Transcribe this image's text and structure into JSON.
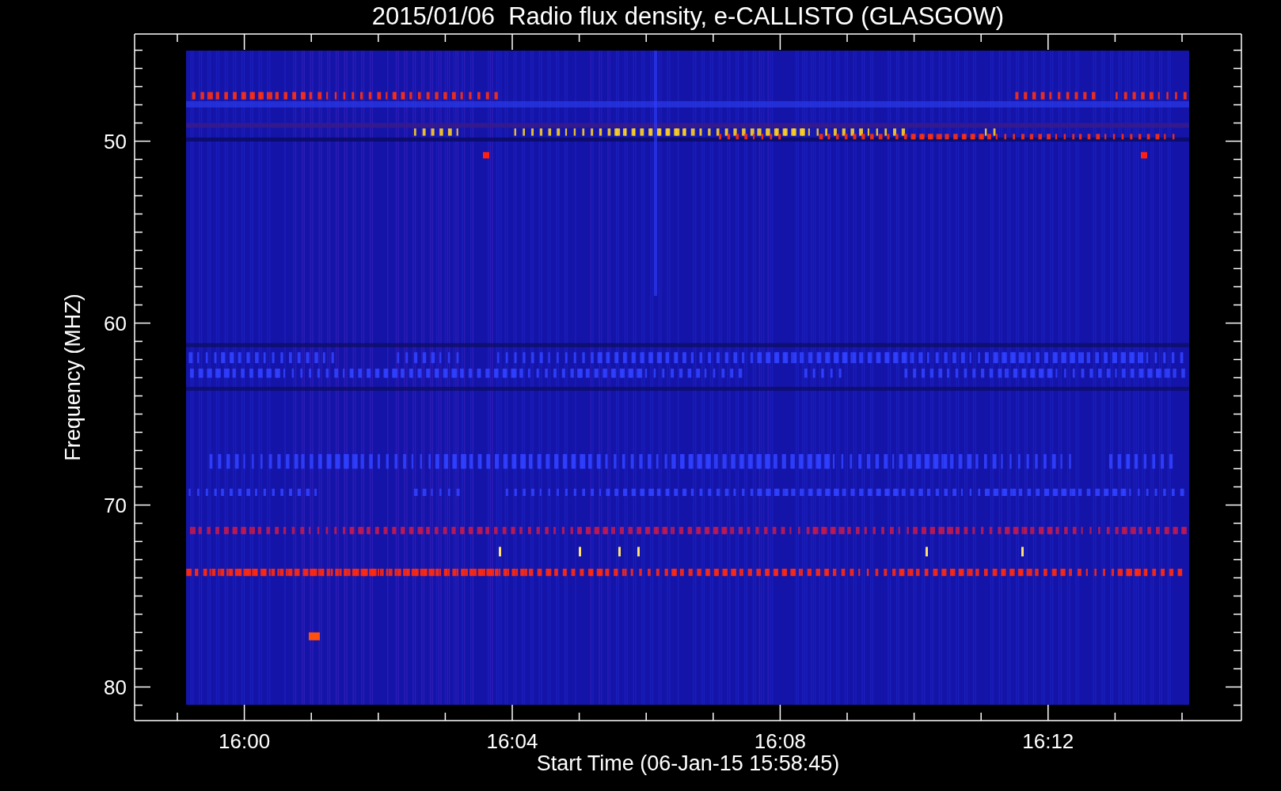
{
  "title": "2015/01/06  Radio flux density, e-CALLISTO (GLASGOW)",
  "ylabel": "Frequency (MHZ)",
  "xlabel": "Start Time (06-Jan-15 15:58:45)",
  "y_tick_labels": [
    "50",
    "60",
    "70",
    "80"
  ],
  "x_tick_labels": [
    "16:00",
    "16:04",
    "16:08",
    "16:12"
  ]
}
